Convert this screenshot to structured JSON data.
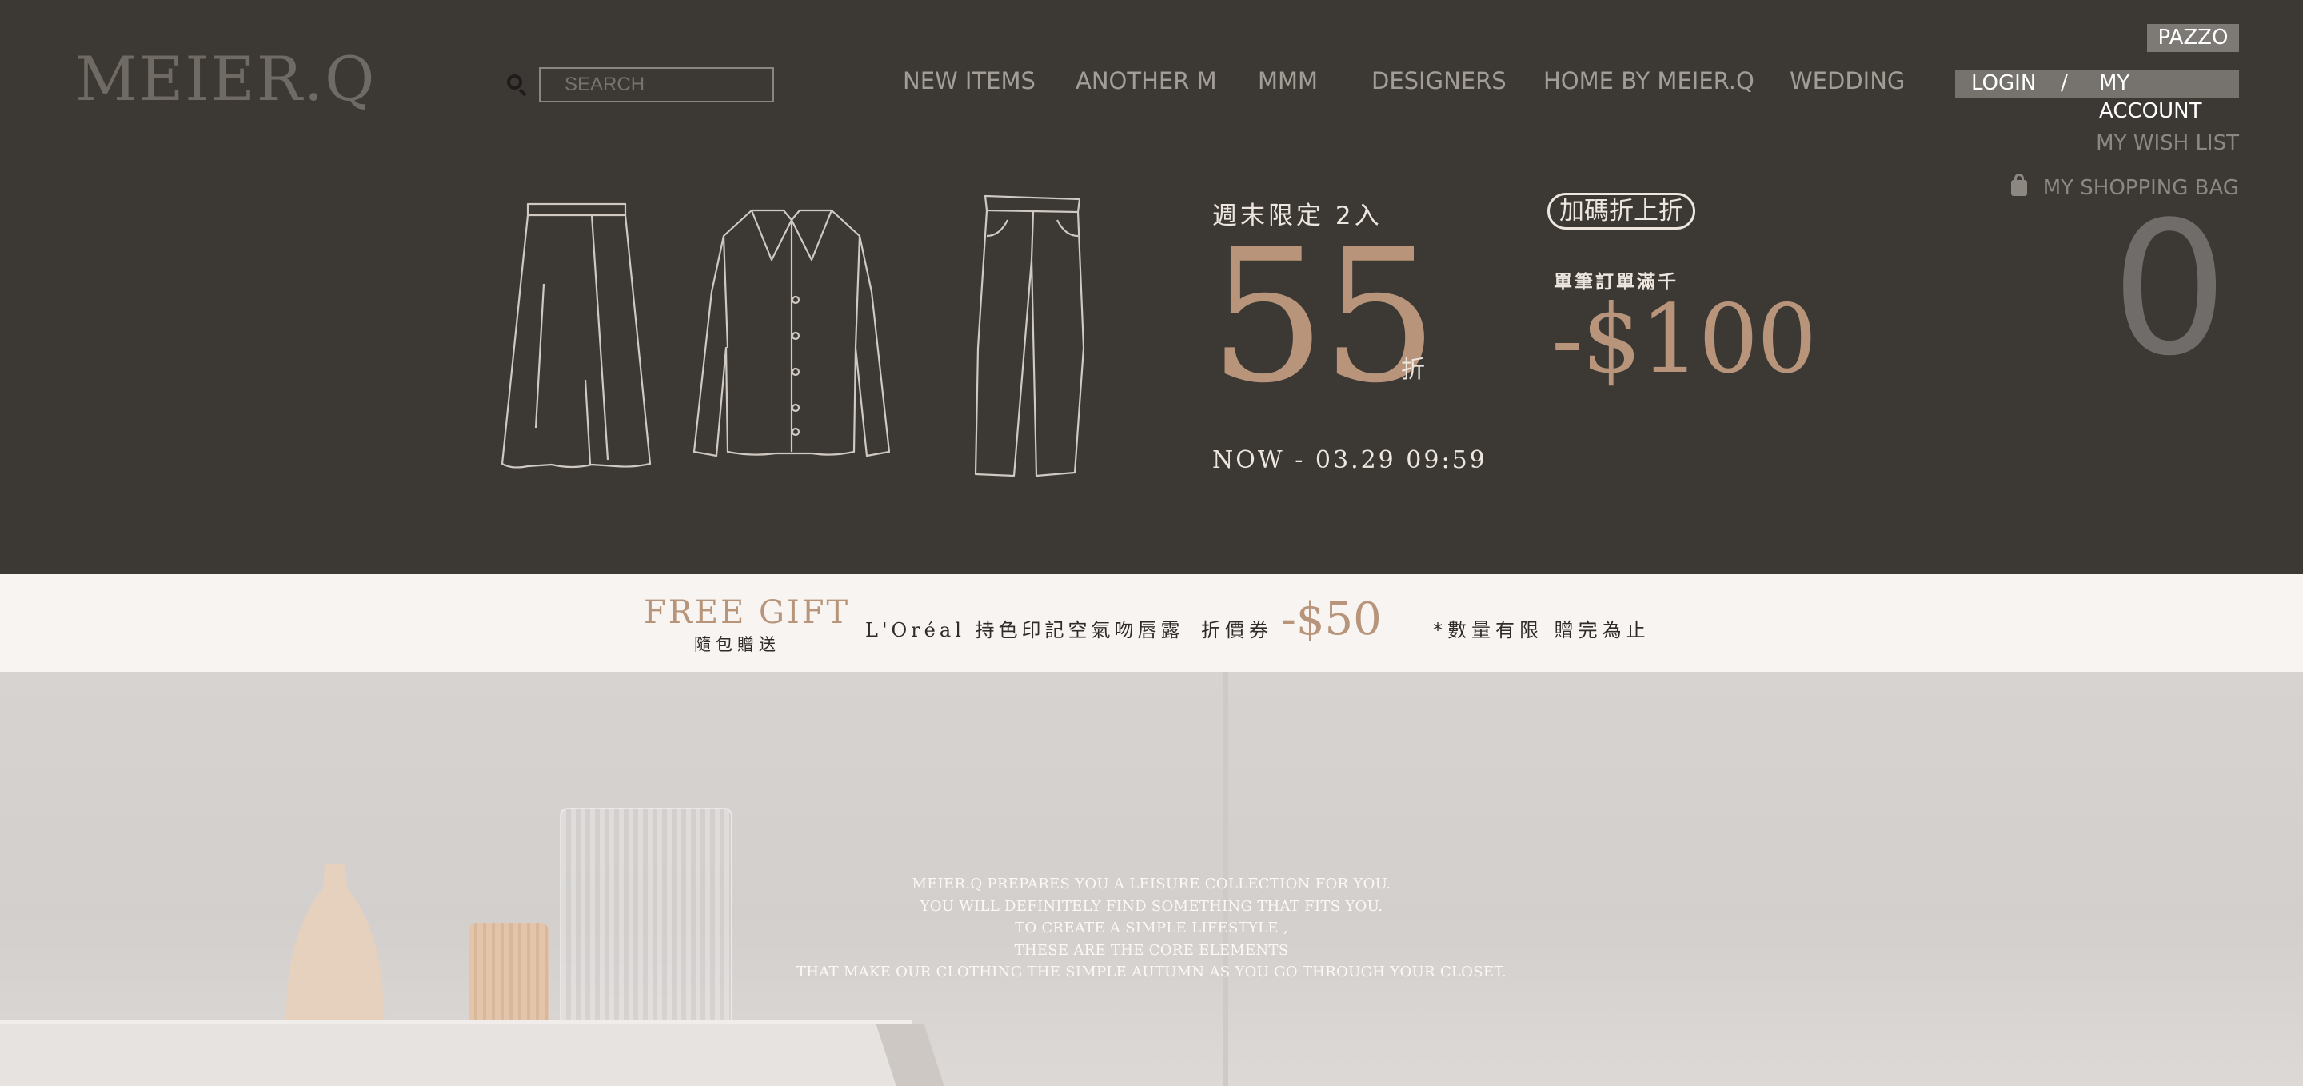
{
  "header": {
    "logo": "MEIER.Q",
    "search_placeholder": "SEARCH",
    "nav": [
      "NEW ITEMS",
      "ANOTHER M",
      "MMM",
      "DESIGNERS",
      "HOME BY MEIER.Q",
      "WEDDING"
    ],
    "pazzo": "PAZZO",
    "login": "LOGIN",
    "separator": "/",
    "account": "MY ACCOUNT",
    "wish_list": "MY WISH LIST",
    "shopping_bag": "MY SHOPPING BAG",
    "bag_count": "0"
  },
  "promo": {
    "weekend": "週末限定 2入",
    "discount": "55",
    "discount_unit": "折",
    "period": "NOW - 03.29 09:59",
    "badge": "加碼折上折",
    "order_threshold": "單筆訂單滿千",
    "extra_off": "-$100"
  },
  "gift": {
    "title": "FREE GIFT",
    "subtitle": "隨包贈送",
    "item": "L'Oréal 持色印記空氣吻唇露",
    "coupon_label": "折價券",
    "coupon_value": "-$50",
    "limit": "*數量有限 贈完為止"
  },
  "lifestyle": {
    "lines": [
      "MEIER.Q PREPARES YOU A LEISURE COLLECTION FOR YOU.",
      "YOU WILL DEFINITELY FIND SOMETHING THAT FITS YOU.",
      "TO CREATE A SIMPLE LIFESTYLE ,",
      "THESE ARE THE CORE ELEMENTS",
      "THAT MAKE OUR CLOTHING THE SIMPLE AUTUMN AS YOU GO THROUGH YOUR CLOSET."
    ]
  },
  "colors": {
    "hero_bg": "#3c3834",
    "accent": "#b8957a",
    "band_bg": "#f8f4f1"
  },
  "icons": [
    "search-icon",
    "shopping-bag-icon"
  ]
}
